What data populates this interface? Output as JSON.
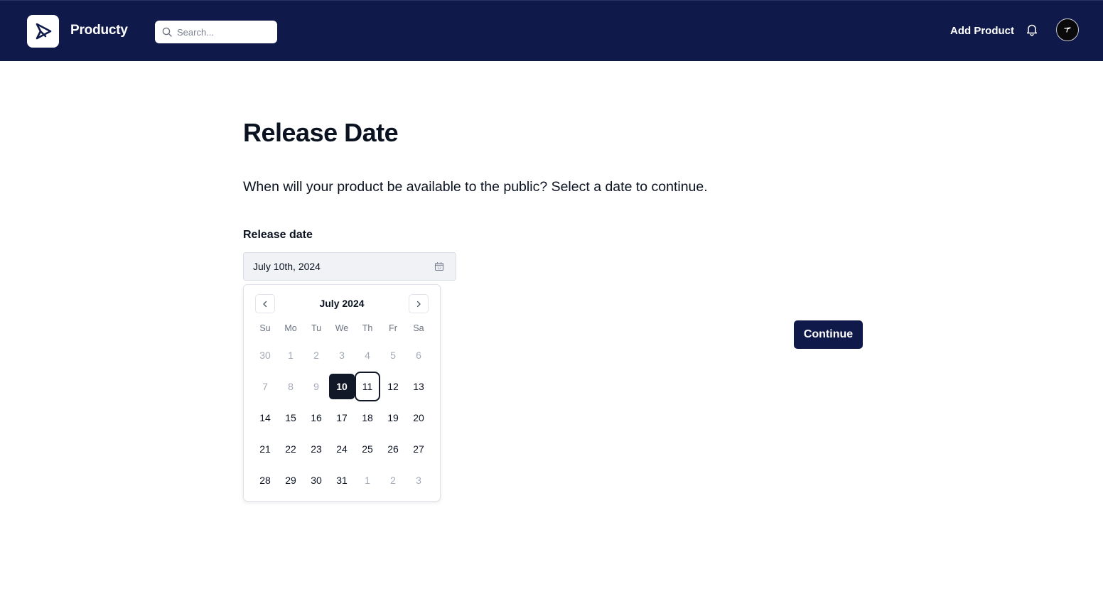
{
  "header": {
    "brand": "Producty",
    "search_placeholder": "Search...",
    "add_product_label": "Add Product"
  },
  "main": {
    "title": "Release Date",
    "subtitle": "When will your product be available to the public? Select a date to continue.",
    "field_label": "Release date",
    "date_value": "July 10th, 2024",
    "continue_label": "Continue"
  },
  "calendar": {
    "month_label": "July 2024",
    "weekdays": [
      "Su",
      "Mo",
      "Tu",
      "We",
      "Th",
      "Fr",
      "Sa"
    ],
    "days": [
      {
        "label": "30",
        "muted": true
      },
      {
        "label": "1",
        "muted": true
      },
      {
        "label": "2",
        "muted": true
      },
      {
        "label": "3",
        "muted": true
      },
      {
        "label": "4",
        "muted": true
      },
      {
        "label": "5",
        "muted": true
      },
      {
        "label": "6",
        "muted": true
      },
      {
        "label": "7",
        "muted": true
      },
      {
        "label": "8",
        "muted": true
      },
      {
        "label": "9",
        "muted": true
      },
      {
        "label": "10",
        "selected": true
      },
      {
        "label": "11",
        "focused": true
      },
      {
        "label": "12"
      },
      {
        "label": "13"
      },
      {
        "label": "14"
      },
      {
        "label": "15"
      },
      {
        "label": "16"
      },
      {
        "label": "17"
      },
      {
        "label": "18"
      },
      {
        "label": "19"
      },
      {
        "label": "20"
      },
      {
        "label": "21"
      },
      {
        "label": "22"
      },
      {
        "label": "23"
      },
      {
        "label": "24"
      },
      {
        "label": "25"
      },
      {
        "label": "26"
      },
      {
        "label": "27"
      },
      {
        "label": "28"
      },
      {
        "label": "29"
      },
      {
        "label": "30"
      },
      {
        "label": "31"
      },
      {
        "label": "1",
        "muted": true
      },
      {
        "label": "2",
        "muted": true
      },
      {
        "label": "3",
        "muted": true
      }
    ]
  },
  "colors": {
    "navbar": "#101a4a",
    "selected_day": "#111827",
    "muted_day": "#a3a9b5"
  },
  "icons": [
    "logo-icon",
    "search-icon",
    "bell-icon",
    "avatar",
    "calendar-icon",
    "chevron-left-icon",
    "chevron-right-icon"
  ]
}
